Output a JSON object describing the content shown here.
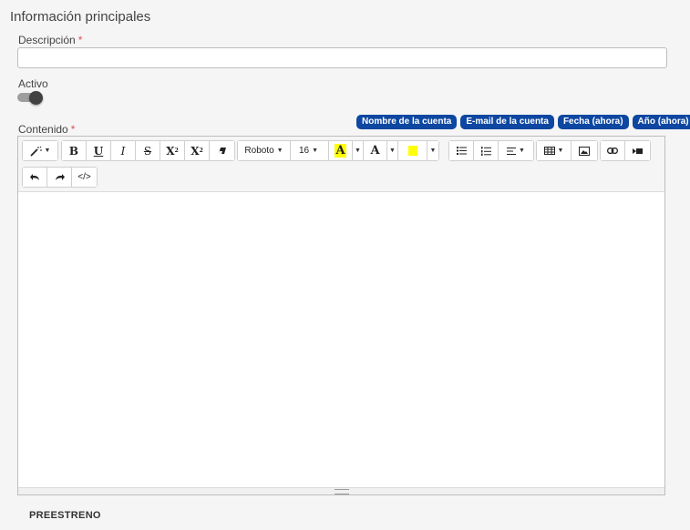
{
  "section_title": "Información principales",
  "description": {
    "label": "Descripción",
    "required_mark": "*",
    "value": ""
  },
  "active": {
    "label": "Activo",
    "enabled": false
  },
  "content": {
    "label": "Contenido",
    "required_mark": "*",
    "placeholders": [
      "Nombre de la cuenta",
      "E-mail de la cuenta",
      "Fecha (ahora)",
      "Año (ahora)"
    ]
  },
  "toolbar": {
    "font_name": "Roboto",
    "font_size": "16",
    "text_color_glyph": "A",
    "back_color_glyph": "A",
    "bold": "B",
    "underline": "U",
    "italic": "I",
    "strikethrough": "S",
    "superscript": "X",
    "superscript_mark": "2",
    "subscript": "X",
    "subscript_mark": "2",
    "codeview": "</>",
    "highlight_color": "#ffff00"
  },
  "preview_label": "PREESTRENO",
  "colors": {
    "chip": "#0d47a1",
    "required": "#d9534f"
  }
}
